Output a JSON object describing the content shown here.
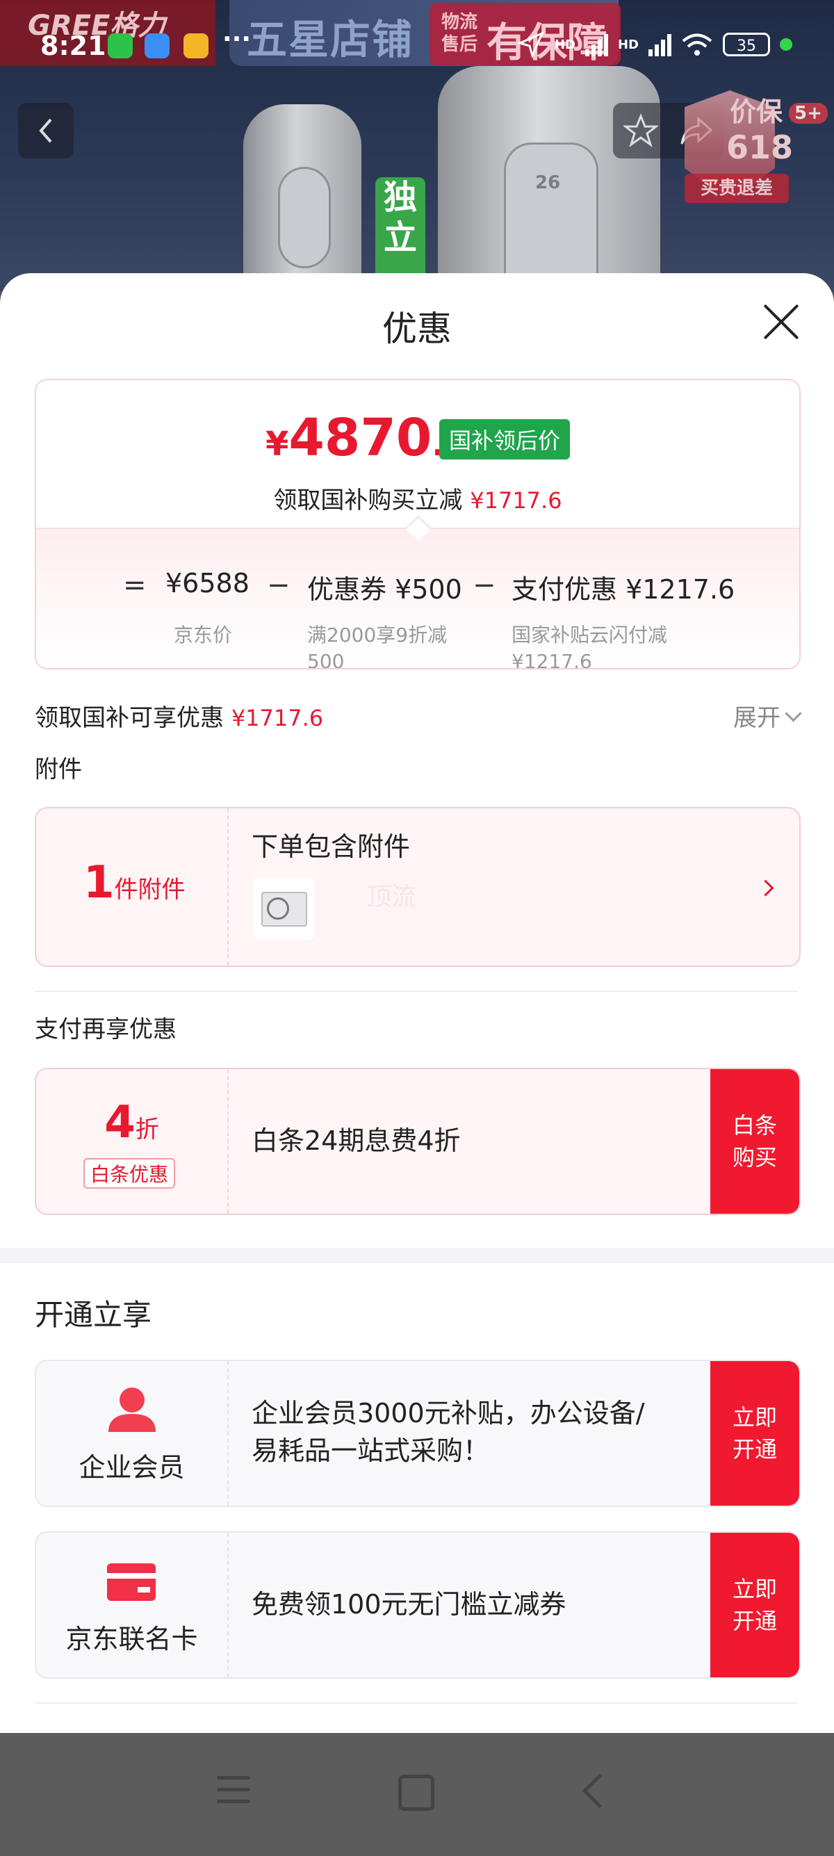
{
  "status_bar": {
    "time": "8:21",
    "more": "···",
    "network_1": "HD",
    "network_2": "HD",
    "battery": "35"
  },
  "banner": {
    "brand": "GREE格力",
    "promo_main": "五星店铺",
    "promo_small": "物流\n售后",
    "promo_guarantee": "有保障",
    "flag_text": "独立",
    "ac_display_1": "26",
    "badge_title": "价保",
    "badge_618": "618",
    "badge_ribbon": "买贵退差",
    "badge_count": "5+"
  },
  "sheet": {
    "title": "优惠",
    "price": {
      "currency": "¥",
      "integer": "4870",
      "decimal": ".4",
      "tag": "国补领后价",
      "line_prefix": "领取国补购买立减",
      "line_amount": "¥1717.6"
    },
    "calc": {
      "equals": "=",
      "minus": "−",
      "items": [
        {
          "value": "¥6588",
          "note": "京东价"
        },
        {
          "value": "优惠券 ¥500",
          "note": "满2000享9折减\n500"
        },
        {
          "value": "支付优惠 ¥1217.6",
          "note": "国家补贴云闪付减\n¥1217.6"
        }
      ]
    },
    "subsidy_row": {
      "label": "领取国补可享优惠",
      "amount": "¥1717.6",
      "expand": "展开"
    },
    "accessory": {
      "section_title": "附件",
      "count": "1",
      "count_unit": "件附件",
      "title": "下单包含附件",
      "watermark": "顶流"
    },
    "payment": {
      "section_title": "支付再享优惠",
      "discount_num": "4",
      "discount_unit": "折",
      "tag": "白条优惠",
      "desc": "白条24期息费4折",
      "button": "白条\n购买"
    },
    "membership": {
      "section_title": "开通立享",
      "items": [
        {
          "name": "企业会员",
          "desc": "企业会员3000元补贴，办公设备/\n易耗品一站式采购！",
          "button": "立即\n开通",
          "icon": "person-icon"
        },
        {
          "name": "京东联名卡",
          "desc": "免费领100元无门槛立减券",
          "button": "立即\n开通",
          "icon": "card-icon"
        }
      ]
    }
  },
  "colors": {
    "accent_red": "#e8192f",
    "button_red": "#f0192f",
    "tag_green": "#1fa54a"
  }
}
